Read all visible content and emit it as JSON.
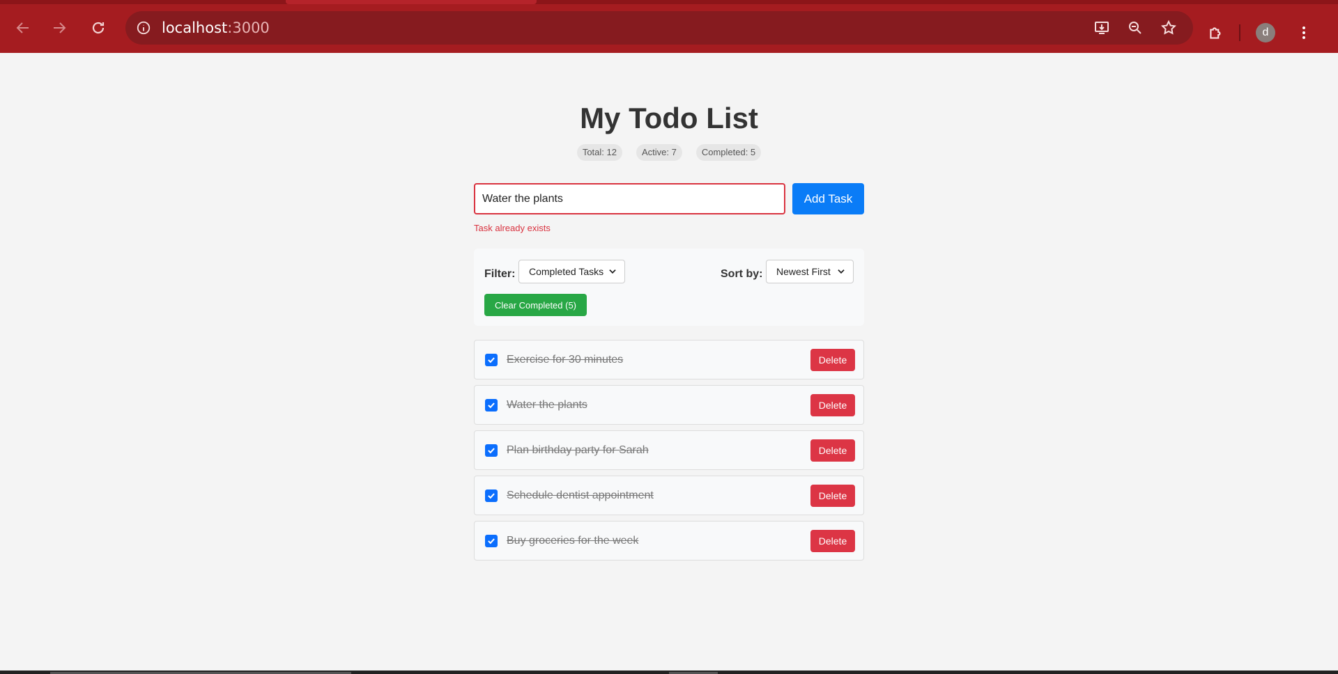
{
  "browser": {
    "url_host": "localhost",
    "url_port": ":3000",
    "profile_initial": "d",
    "theme_color": "#a51c20"
  },
  "app": {
    "title": "My Todo List",
    "stats": {
      "total": "Total: 12",
      "active": "Active: 7",
      "completed": "Completed: 5"
    },
    "input": {
      "value": "Water the plants",
      "add_label": "Add Task",
      "error": "Task already exists"
    },
    "controls": {
      "filter_label": "Filter:",
      "filter_value": "Completed Tasks",
      "sort_label": "Sort by:",
      "sort_value": "Newest First",
      "clear_label": "Clear Completed (5)"
    },
    "todos": [
      {
        "text": "Exercise for 30 minutes",
        "completed": true,
        "delete_label": "Delete"
      },
      {
        "text": "Water the plants",
        "completed": true,
        "delete_label": "Delete"
      },
      {
        "text": "Plan birthday party for Sarah",
        "completed": true,
        "delete_label": "Delete"
      },
      {
        "text": "Schedule dentist appointment",
        "completed": true,
        "delete_label": "Delete"
      },
      {
        "text": "Buy groceries for the week",
        "completed": true,
        "delete_label": "Delete"
      }
    ],
    "colors": {
      "primary": "#0a7cf7",
      "danger": "#dc3545",
      "success": "#28a745",
      "error_text": "#d9323f"
    }
  }
}
